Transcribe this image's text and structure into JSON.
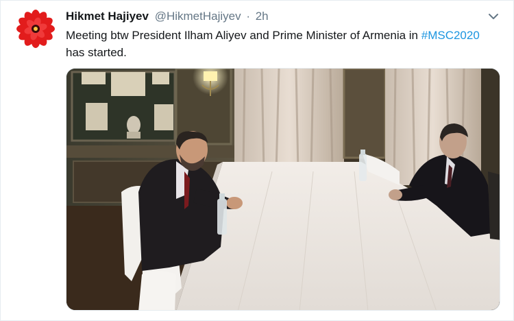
{
  "tweet": {
    "display_name": "Hikmet Hajiyev",
    "handle": "@HikmetHajiyev",
    "separator": "·",
    "time": "2h",
    "text_before": "Meeting btw President Ilham Aliyev and Prime Minister of Armenia in ",
    "hashtag": "#MSC2020",
    "text_after": " has started.",
    "avatar_icon": "red-flower-icon",
    "menu_icon": "chevron-down-icon",
    "colors": {
      "name": "#14171a",
      "muted": "#657786",
      "link": "#1b95e0",
      "avatar": "#e02020"
    }
  }
}
